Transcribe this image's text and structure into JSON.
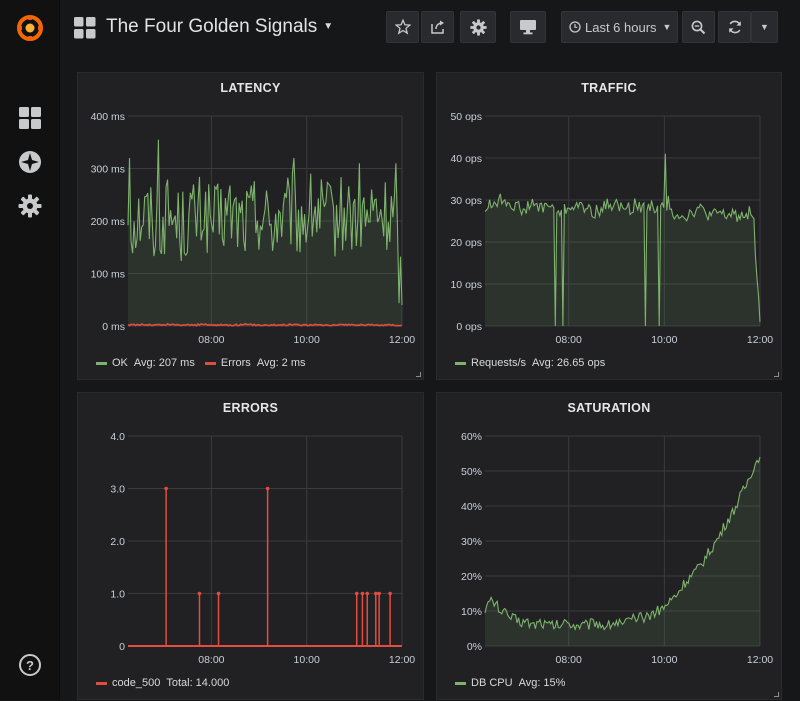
{
  "sidebar": {
    "items": [
      {
        "name": "grafana-logo-icon"
      },
      {
        "name": "dashboards-icon"
      },
      {
        "name": "explore-icon"
      },
      {
        "name": "configuration-icon"
      },
      {
        "name": "help-icon",
        "label": "?"
      }
    ]
  },
  "navbar": {
    "title": "The Four Golden Signals",
    "time_range": "Last 6 hours"
  },
  "colors": {
    "green": "#7eb26d",
    "red": "#e24d42"
  },
  "panels": {
    "latency": {
      "title": "LATENCY",
      "legend": [
        {
          "name": "OK",
          "stat": "Avg: 207 ms",
          "color": "#7eb26d"
        },
        {
          "name": "Errors",
          "stat": "Avg: 2 ms",
          "color": "#e24d42"
        }
      ]
    },
    "traffic": {
      "title": "TRAFFIC",
      "legend": [
        {
          "name": "Requests/s",
          "stat": "Avg: 26.65 ops",
          "color": "#7eb26d"
        }
      ]
    },
    "errors": {
      "title": "ERRORS",
      "legend": [
        {
          "name": "code_500",
          "stat": "Total: 14.000",
          "color": "#e24d42"
        }
      ]
    },
    "saturation": {
      "title": "SATURATION",
      "legend": [
        {
          "name": "DB CPU",
          "stat": "Avg: 15%",
          "color": "#7eb26d"
        }
      ]
    }
  },
  "chart_data": [
    {
      "id": "latency",
      "type": "line",
      "title": "LATENCY",
      "x_ticks": [
        "08:00",
        "10:00",
        "12:00"
      ],
      "x_range": [
        "06:15",
        "12:00"
      ],
      "y_ticks": [
        "0 ms",
        "100 ms",
        "200 ms",
        "300 ms",
        "400 ms"
      ],
      "ylim": [
        0,
        400
      ],
      "grid": true,
      "series": [
        {
          "name": "OK",
          "color": "#7eb26d",
          "fill": true,
          "noise": 75,
          "values": [
            205,
            200,
            215,
            210,
            195,
            205,
            215,
            200,
            190,
            210,
            205,
            220,
            200,
            195,
            210,
            215,
            205,
            200,
            210,
            220,
            205,
            195,
            210,
            205,
            215,
            200,
            210,
            220,
            215,
            205,
            200,
            210,
            215,
            205,
            210,
            200,
            215,
            210,
            205,
            210,
            40
          ],
          "spikes": [
            [
              4.5,
              355
            ],
            [
              0.25,
              320
            ],
            [
              24.2,
              320
            ],
            [
              33.8,
              310
            ],
            [
              39.2,
              310
            ]
          ]
        },
        {
          "name": "Errors",
          "color": "#e24d42",
          "fill": false,
          "noise": 1.5,
          "values": [
            2,
            2,
            3,
            2,
            2,
            2,
            3,
            2,
            2,
            2,
            2,
            3,
            2,
            2,
            2,
            2,
            2,
            3,
            2,
            2,
            2,
            2,
            2,
            2,
            3,
            2,
            2,
            2,
            2,
            2,
            2,
            2,
            3,
            2,
            2,
            2,
            2,
            2,
            2,
            2,
            1
          ]
        }
      ]
    },
    {
      "id": "traffic",
      "type": "line",
      "title": "TRAFFIC",
      "x_ticks": [
        "08:00",
        "10:00",
        "12:00"
      ],
      "x_range": [
        "06:15",
        "12:00"
      ],
      "y_ticks": [
        "0 ops",
        "10 ops",
        "20 ops",
        "30 ops",
        "40 ops",
        "50 ops"
      ],
      "ylim": [
        0,
        50
      ],
      "grid": true,
      "series": [
        {
          "name": "Requests/s",
          "color": "#7eb26d",
          "fill": true,
          "noise": 1.6,
          "values": [
            28,
            29,
            30,
            30,
            29,
            28,
            28,
            29,
            28,
            29,
            28,
            27,
            28,
            29,
            28,
            28,
            27,
            28,
            29,
            29,
            28,
            28,
            29,
            28,
            29,
            28,
            28,
            27,
            27,
            26,
            27,
            28,
            27,
            26,
            27,
            26,
            27,
            26,
            27,
            27,
            1
          ],
          "spikes": [
            [
              10.2,
              0
            ],
            [
              11.4,
              0
            ],
            [
              23.4,
              0
            ],
            [
              25.3,
              0
            ],
            [
              26.2,
              41
            ],
            [
              26.6,
              31
            ]
          ]
        }
      ]
    },
    {
      "id": "errors",
      "type": "line",
      "title": "ERRORS",
      "x_ticks": [
        "08:00",
        "10:00",
        "12:00"
      ],
      "x_range": [
        "06:15",
        "12:00"
      ],
      "y_ticks": [
        "0",
        "1.0",
        "2.0",
        "3.0",
        "4.0"
      ],
      "ylim": [
        0,
        4
      ],
      "grid": true,
      "series": [
        {
          "name": "code_500",
          "color": "#e24d42",
          "fill": false,
          "bars": true,
          "points": [
            [
              7.05,
              3
            ],
            [
              7.75,
              1
            ],
            [
              8.15,
              1
            ],
            [
              9.18,
              3
            ],
            [
              11.05,
              1
            ],
            [
              11.17,
              1
            ],
            [
              11.27,
              1
            ],
            [
              11.45,
              1
            ],
            [
              11.52,
              1
            ],
            [
              11.75,
              1
            ]
          ]
        }
      ]
    },
    {
      "id": "saturation",
      "type": "line",
      "title": "SATURATION",
      "x_ticks": [
        "08:00",
        "10:00",
        "12:00"
      ],
      "x_range": [
        "06:15",
        "12:00"
      ],
      "y_ticks": [
        "0%",
        "10%",
        "20%",
        "30%",
        "40%",
        "50%",
        "60%"
      ],
      "ylim": [
        0,
        60
      ],
      "grid": true,
      "series": [
        {
          "name": "DB CPU",
          "color": "#7eb26d",
          "fill": true,
          "noise": 1.6,
          "values": [
            11,
            13,
            11,
            9,
            8,
            7,
            7,
            6,
            7,
            6,
            6,
            6,
            7,
            6,
            6,
            6,
            7,
            6,
            6,
            7,
            6,
            7,
            8,
            8,
            9,
            10,
            11,
            13,
            15,
            18,
            20,
            22,
            25,
            28,
            31,
            35,
            38,
            42,
            46,
            51,
            54
          ]
        }
      ]
    }
  ]
}
